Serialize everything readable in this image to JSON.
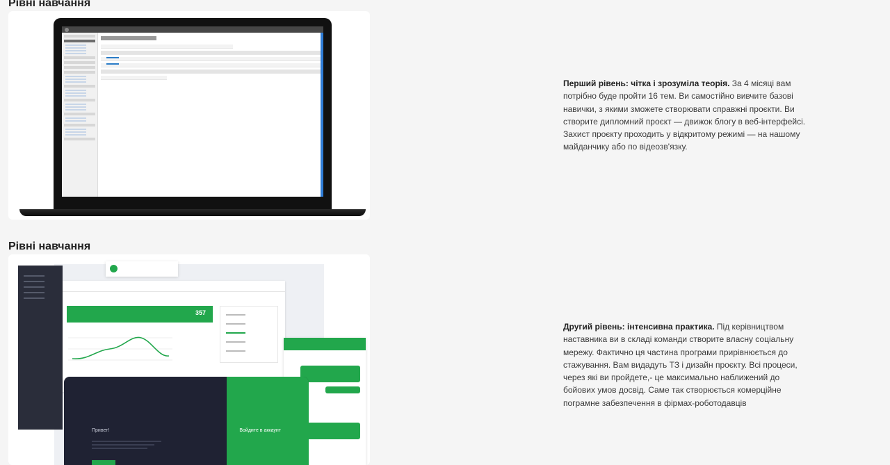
{
  "sections": [
    {
      "title": "Рівні навчання",
      "description_bold": "Перший рівень: чітка і зрозуміла теорія.",
      "description_text": " За 4 місяці вам потрібно буде пройти 16 тем. Ви самостійно вивчите базові навички, з якими зможете створювати справжні проєкти. Ви створите дипломний проєкт — движок блогу в веб-інтерфейсі. Захист проєкту проходить у відкритому режимі — на нашому майданчику або по відеозв'язку."
    },
    {
      "title": "Рівні навчання",
      "description_bold": "Другий рівень: інтенсивна практика.",
      "description_text": " Під керівництвом наставника ви в складі команди створите власну соціальну мережу. Фактично ця частина програми прирівнюється до стажування. Вам видадуть ТЗ і дизайн проєкту. Всі процеси, через які ви пройдете,- це максимально наближений до бойових умов досвід. Саме так створюється комерційне пограмне забезпечення в фірмах-роботодавців"
    }
  ],
  "mockup2": {
    "stat_number": "357",
    "tablet_greeting": "Привет!",
    "tablet_login": "Войдите в аккаунт"
  },
  "colors": {
    "accent_green": "#22a74c",
    "wp_blue": "#2e7cd6"
  }
}
